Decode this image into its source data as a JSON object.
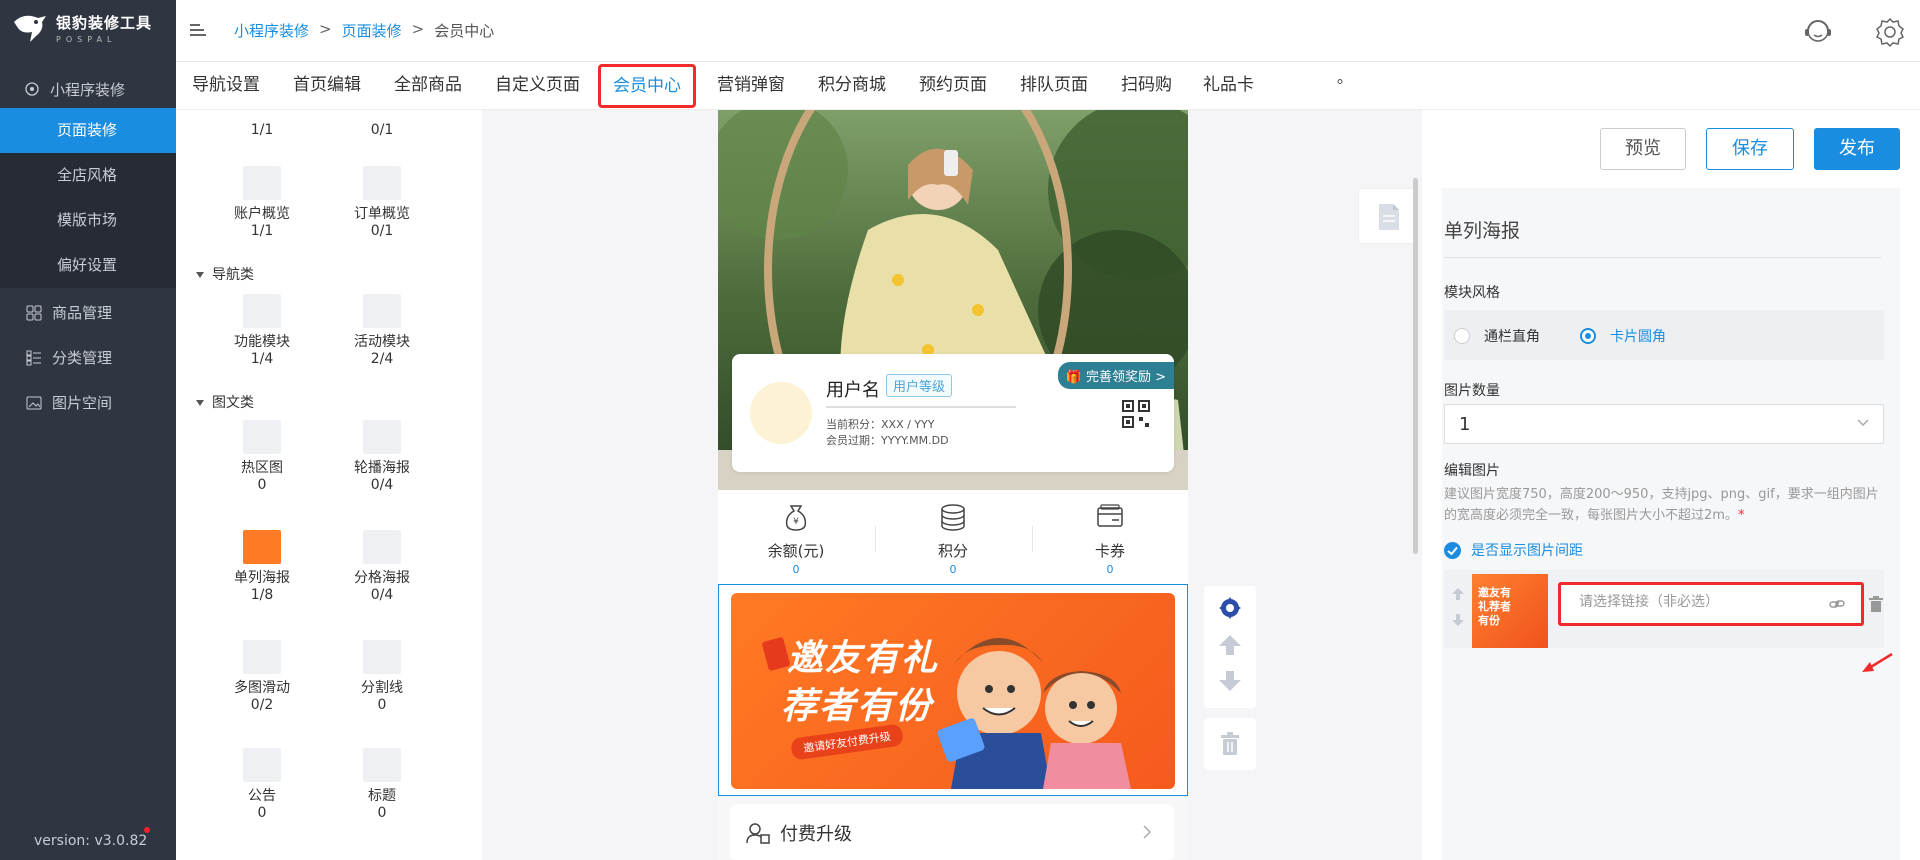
{
  "app": {
    "logo_title": "银豹装修工具",
    "logo_sub": "POSPAL",
    "version": "version: v3.0.82"
  },
  "sidebar": {
    "top_item": "小程序装修",
    "sub_items": [
      "页面装修",
      "全店风格",
      "模版市场",
      "偏好设置"
    ],
    "active_sub": 0,
    "items": [
      "商品管理",
      "分类管理",
      "图片空间"
    ]
  },
  "breadcrumb": [
    "小程序装修",
    "页面装修",
    "会员中心"
  ],
  "breadcrumb_sep": ">",
  "tabs": [
    "导航设置",
    "首页编辑",
    "全部商品",
    "自定义页面",
    "会员中心",
    "营销弹窗",
    "积分商城",
    "预约页面",
    "排队页面",
    "扫码购",
    "礼品卡"
  ],
  "tabs_extra": "°",
  "active_tab": 4,
  "palette": {
    "top_counts": [
      "1/1",
      "0/1"
    ],
    "row1": [
      {
        "label": "账户概览",
        "count": "1/1"
      },
      {
        "label": "订单概览",
        "count": "0/1"
      }
    ],
    "section_nav": "导航类",
    "row2": [
      {
        "label": "功能模块",
        "count": "1/4"
      },
      {
        "label": "活动模块",
        "count": "2/4"
      }
    ],
    "section_media": "图文类",
    "row3": [
      {
        "label": "热区图",
        "count": "0"
      },
      {
        "label": "轮播海报",
        "count": "0/4"
      }
    ],
    "row4": [
      {
        "label": "单列海报",
        "count": "1/8"
      },
      {
        "label": "分格海报",
        "count": "0/4"
      }
    ],
    "row5": [
      {
        "label": "多图滑动",
        "count": "0/2"
      },
      {
        "label": "分割线",
        "count": "0"
      }
    ],
    "row6": [
      {
        "label": "公告",
        "count": "0"
      },
      {
        "label": "标题",
        "count": "0"
      }
    ]
  },
  "preview": {
    "username": "用户名",
    "level": "用户等级",
    "points_line": "当前积分：XXX / YYY",
    "expire_line": "会员过期：YYYY.MM.DD",
    "award": "完善领奖励 >",
    "stats": [
      {
        "label": "余额(元)",
        "value": "0"
      },
      {
        "label": "积分",
        "value": "0"
      },
      {
        "label": "卡券",
        "value": "0"
      }
    ],
    "banner_line1": "邀友有礼",
    "banner_line2": "荐者有份",
    "banner_tag": "邀请好友付费升级",
    "upgrade": "付费升级"
  },
  "right_panel": {
    "preview_btn": "预览",
    "save_btn": "保存",
    "publish_btn": "发布",
    "title": "单列海报",
    "style_label": "模块风格",
    "style_options": [
      "通栏直角",
      "卡片圆角"
    ],
    "style_selected": 1,
    "count_label": "图片数量",
    "count_value": "1",
    "edit_label": "编辑图片",
    "hint": "建议图片宽度750，高度200～950，支持jpg、png、gif，要求一组内图片的宽高度必须完全一致，每张图片大小不超过2m。",
    "hint_star": "*",
    "show_spacing": "是否显示图片间距",
    "link_placeholder": "请选择链接（非必选）",
    "thumb_text": "邀友有礼荐者有份"
  },
  "colors": {
    "accent": "#1a8de0",
    "sidebar": "#2f3541",
    "highlight": "#f12b2b",
    "banner": "#ff7a24"
  }
}
